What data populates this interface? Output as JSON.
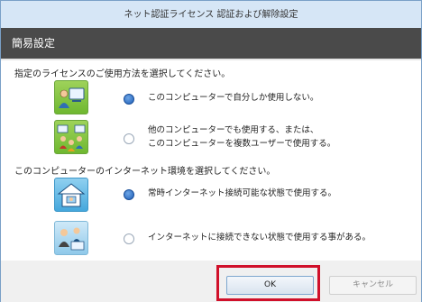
{
  "window": {
    "title": "ネット認証ライセンス 認証および解除設定"
  },
  "header": {
    "title": "簡易設定"
  },
  "section1": {
    "question": "指定のライセンスのご使用方法を選択してください。",
    "options": [
      {
        "label": "このコンピューターで自分しか使用しない。",
        "selected": true,
        "icon": "single-user-computer-icon"
      },
      {
        "label_line1": "他のコンピューターでも使用する、または、",
        "label_line2": "このコンピューターを複数ユーザーで使用する。",
        "selected": false,
        "icon": "multi-user-computers-icon"
      }
    ]
  },
  "section2": {
    "question": "このコンピューターのインターネット環境を選択してください。",
    "options": [
      {
        "label": "常時インターネット接続可能な状態で使用する。",
        "selected": true,
        "icon": "house-online-icon"
      },
      {
        "label": "インターネットに接続できない状態で使用する事がある。",
        "selected": false,
        "icon": "offline-users-icon"
      }
    ]
  },
  "buttons": {
    "ok": "OK",
    "cancel": "キャンセル"
  },
  "colors": {
    "highlight": "#d0102a",
    "header_bg": "#4a4a4a",
    "titlebar_bg": "#d6e6f6"
  }
}
